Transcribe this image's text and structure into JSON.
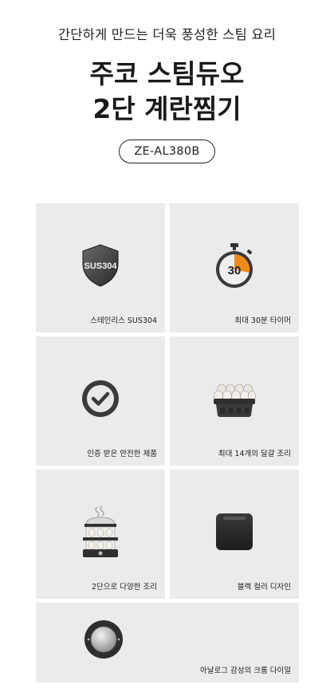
{
  "header": {
    "subtitle": "간단하게 만드는 더욱 풍성한 스팀 요리",
    "title_line1": "주코 스팀듀오",
    "title_line2": "2단 계란찜기",
    "model": "ZE-AL380B"
  },
  "features": [
    {
      "label": "스테인리스 SUS304",
      "icon": "shield-sus304-icon",
      "icon_text": "SUS304"
    },
    {
      "label": "최대 30분 타이머",
      "icon": "stopwatch-timer-icon",
      "icon_text": "30"
    },
    {
      "label": "인증 받은 안전한 제품",
      "icon": "checkmark-circle-icon"
    },
    {
      "label": "최대 14개의 달걀 조리",
      "icon": "egg-tray-icon"
    },
    {
      "label": "2단으로 다양한 조리",
      "icon": "two-tier-steamer-icon"
    },
    {
      "label": "블랙 컬러 디자인",
      "icon": "black-appliance-icon"
    },
    {
      "label": "아날로그 감성의 크롬 다이얼",
      "icon": "chrome-dial-icon"
    }
  ]
}
